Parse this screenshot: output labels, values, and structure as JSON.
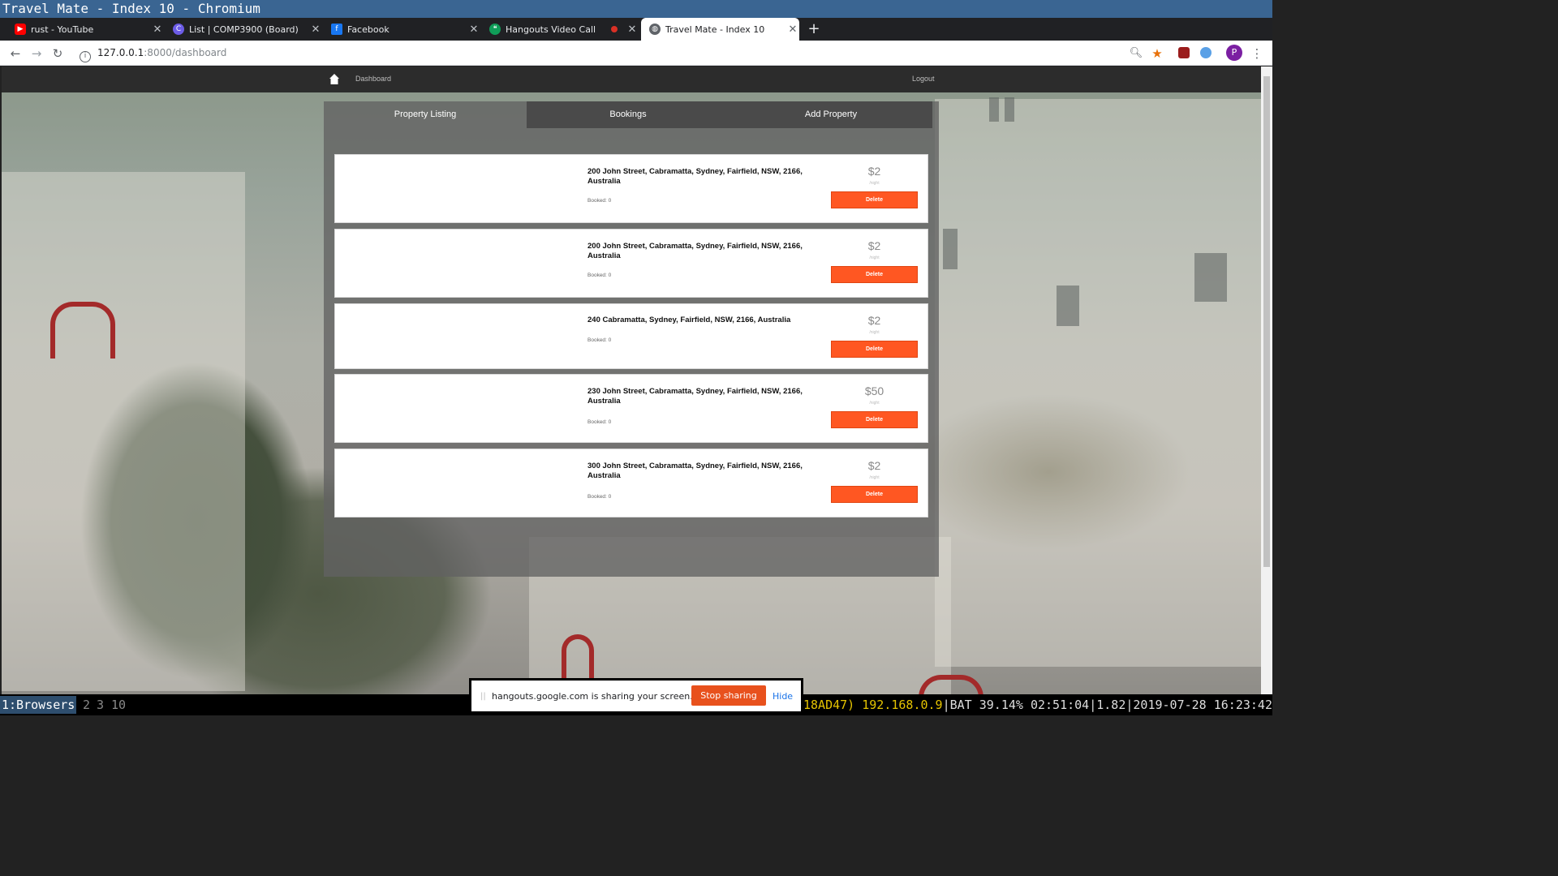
{
  "window": {
    "title": "Travel Mate - Index 10 - Chromium"
  },
  "tabs": [
    {
      "title": "rust - YouTube",
      "icon": "youtube-icon",
      "color": "#ff0000"
    },
    {
      "title": "List | COMP3900 (Board)",
      "icon": "board-icon",
      "color": "#6c5ce7"
    },
    {
      "title": "Facebook",
      "icon": "facebook-icon",
      "color": "#1877f2"
    },
    {
      "title": "Hangouts Video Call",
      "icon": "hangouts-icon",
      "color": "#0f9d58",
      "recording": true
    },
    {
      "title": "Travel Mate - Index 10",
      "icon": "globe-icon",
      "color": "#5f6368",
      "active": true
    }
  ],
  "toolbar": {
    "url_host": "127.0.0.1",
    "url_path": ":8000/dashboard",
    "profile_initial": "P"
  },
  "site": {
    "nav": {
      "dashboard": "Dashboard",
      "logout": "Logout"
    },
    "tabs": [
      "Property Listing",
      "Bookings",
      "Add Property"
    ],
    "active_tab": "Property Listing",
    "listings": [
      {
        "address": "200 John Street, Cabramatta, Sydney, Fairfield, NSW, 2166, Australia",
        "booked": "Booked: 0",
        "price": "$2",
        "unit": "/night",
        "delete": "Delete"
      },
      {
        "address": "200 John Street, Cabramatta, Sydney, Fairfield, NSW, 2166, Australia",
        "booked": "Booked: 0",
        "price": "$2",
        "unit": "/night",
        "delete": "Delete"
      },
      {
        "address": "240 Cabramatta, Sydney, Fairfield, NSW, 2166, Australia",
        "booked": "Booked: 0",
        "price": "$2",
        "unit": "/night",
        "delete": "Delete"
      },
      {
        "address": "230 John Street, Cabramatta, Sydney, Fairfield, NSW, 2166, Australia",
        "booked": "Booked: 0",
        "price": "$50",
        "unit": "/night",
        "delete": "Delete"
      },
      {
        "address": "300 John Street, Cabramatta, Sydney, Fairfield, NSW, 2166, Australia",
        "booked": "Booked: 0",
        "price": "$2",
        "unit": "/night",
        "delete": "Delete"
      }
    ],
    "accent": "#ff5722"
  },
  "share_bar": {
    "message": "hangouts.google.com is sharing your screen.",
    "stop": "Stop sharing",
    "hide": "Hide"
  },
  "statusbar": {
    "workspaces": [
      "1:Browsers",
      "2",
      "3",
      "10"
    ],
    "net": "18AD47)",
    "ip": "192.168.0.9",
    "battery": "BAT 39.14% 02:51:04",
    "load": "1.82",
    "datetime": "2019-07-28 16:23:42"
  }
}
